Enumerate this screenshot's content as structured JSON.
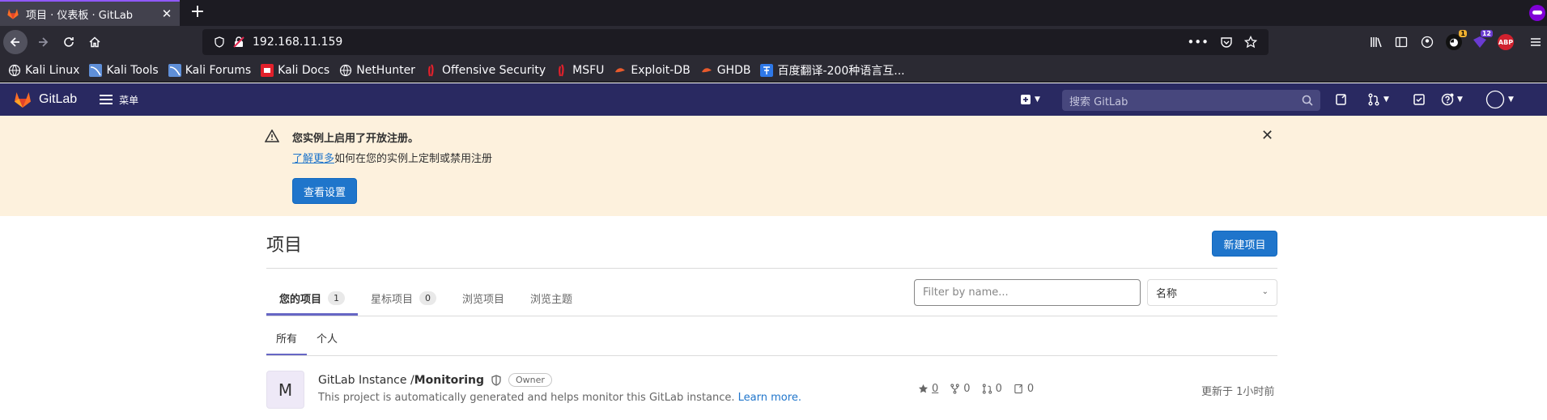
{
  "browser": {
    "tab_title": "项目 · 仪表板 · GitLab",
    "url": "192.168.11.159",
    "extension_badges": [
      "1",
      "12"
    ],
    "abp_label": "ABP",
    "bookmarks": [
      {
        "label": "Kali Linux",
        "icon": "globe-icon",
        "color": "#fbfbfe"
      },
      {
        "label": "Kali Tools",
        "icon": "kali-icon",
        "color": "#5f8fd8"
      },
      {
        "label": "Kali Forums",
        "icon": "kali-icon",
        "color": "#5f8fd8"
      },
      {
        "label": "Kali Docs",
        "icon": "kali-docs-icon",
        "color": "#e2202b"
      },
      {
        "label": "NetHunter",
        "icon": "globe-icon",
        "color": "#fbfbfe"
      },
      {
        "label": "Offensive Security",
        "icon": "offsec-icon",
        "color": "#e2202b"
      },
      {
        "label": "MSFU",
        "icon": "offsec-icon",
        "color": "#e2202b"
      },
      {
        "label": "Exploit-DB",
        "icon": "exploitdb-icon",
        "color": "#e85a2c"
      },
      {
        "label": "GHDB",
        "icon": "exploitdb-icon",
        "color": "#e85a2c"
      },
      {
        "label": "百度翻译-200种语言互...",
        "icon": "translate-icon",
        "color": "#2e78e8"
      }
    ]
  },
  "header": {
    "brand": "GitLab",
    "menu_label": "菜单",
    "search_placeholder": "搜索 GitLab"
  },
  "banner": {
    "title": "您实例上启用了开放注册。",
    "link_text": "了解更多",
    "text": "如何在您的实例上定制或禁用注册",
    "button": "查看设置"
  },
  "main": {
    "title": "项目",
    "new_project": "新建项目",
    "tabs": [
      {
        "label": "您的项目",
        "count": "1"
      },
      {
        "label": "星标项目",
        "count": "0"
      },
      {
        "label": "浏览项目"
      },
      {
        "label": "浏览主题"
      }
    ],
    "filter_placeholder": "Filter by name...",
    "sort_value": "名称",
    "subtabs": [
      "所有",
      "个人"
    ],
    "project": {
      "avatar_letter": "M",
      "namespace": "GitLab Instance / ",
      "name": "Monitoring",
      "role": "Owner",
      "description": "This project is automatically generated and helps monitor this GitLab instance.",
      "learn_more": "Learn more.",
      "stars": "0",
      "forks": "0",
      "merge_requests": "0",
      "issues": "0",
      "updated": "更新于 1小时前"
    }
  },
  "colors": {
    "header_bg": "#292961",
    "banner_bg": "#fdf1dd",
    "primary": "#1f75cb",
    "active_tab": "#6666c4"
  }
}
